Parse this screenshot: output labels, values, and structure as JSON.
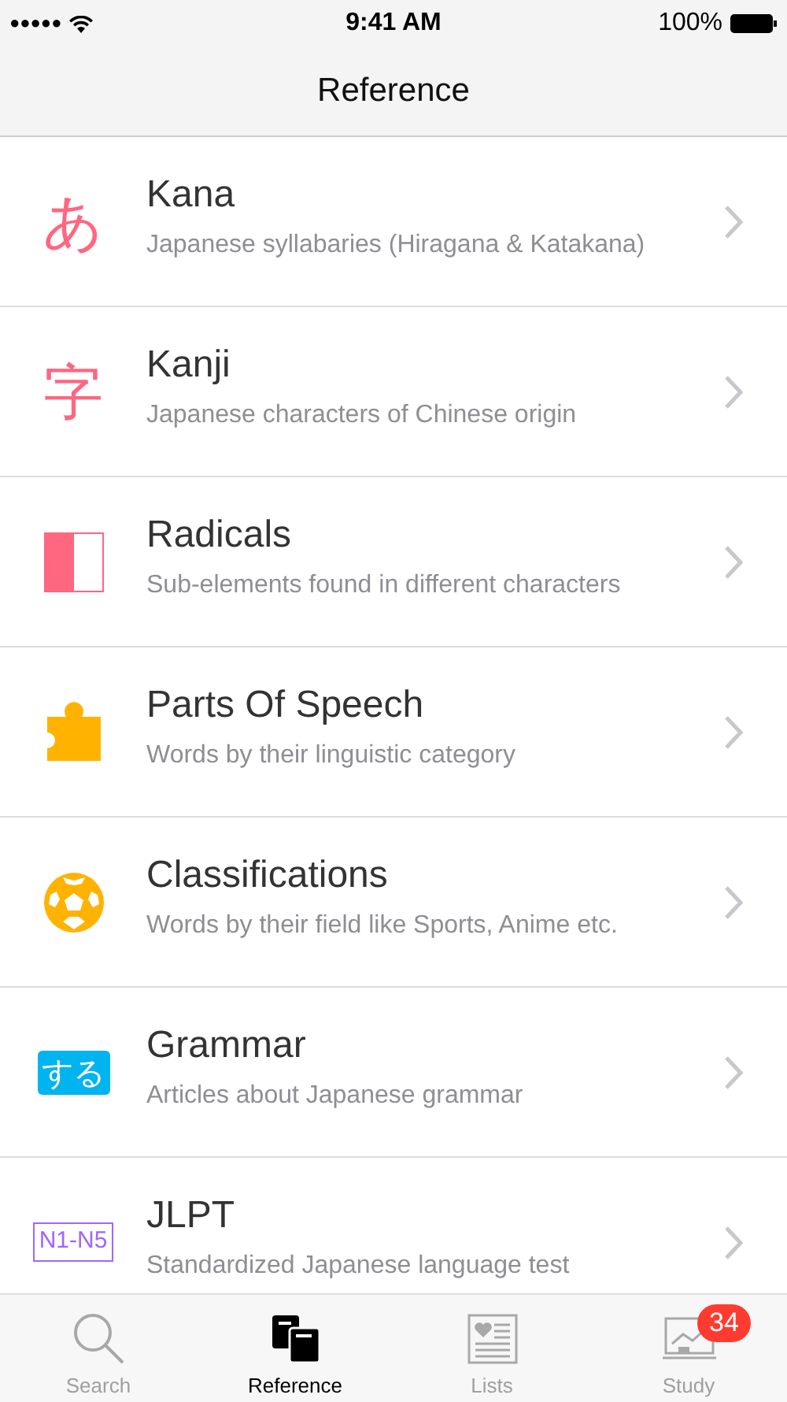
{
  "status_bar": {
    "signal": "●●●●●",
    "time": "9:41 AM",
    "battery": "100%"
  },
  "nav": {
    "title": "Reference"
  },
  "items": [
    {
      "kind": "glyph",
      "icon_text": "あ",
      "color": "#ff6680",
      "title": "Kana",
      "subtitle": "Japanese syllabaries (Hiragana & Katakana)"
    },
    {
      "kind": "glyph",
      "icon_text": "字",
      "color": "#ff6680",
      "title": "Kanji",
      "subtitle": "Japanese characters of Chinese origin"
    },
    {
      "kind": "half-square",
      "color": "#ff6680",
      "title": "Radicals",
      "subtitle": "Sub-elements found in different characters"
    },
    {
      "kind": "puzzle",
      "color": "#ffb300",
      "title": "Parts Of Speech",
      "subtitle": "Words by their linguistic category"
    },
    {
      "kind": "ball",
      "color": "#ffb300",
      "title": "Classifications",
      "subtitle": "Words by their field like Sports, Anime etc."
    },
    {
      "kind": "filled-badge",
      "icon_text": "する",
      "color": "#00b4f0",
      "title": "Grammar",
      "subtitle": "Articles about Japanese grammar"
    },
    {
      "kind": "outline-badge",
      "icon_text": "N1-N5",
      "color": "#a066ff",
      "title": "JLPT",
      "subtitle": "Standardized Japanese language test"
    }
  ],
  "tabs": [
    {
      "kind": "search",
      "label": "Search",
      "selected": false
    },
    {
      "kind": "books",
      "label": "Reference",
      "selected": true
    },
    {
      "kind": "list",
      "label": "Lists",
      "selected": false
    },
    {
      "kind": "study",
      "label": "Study",
      "selected": false,
      "badge": "34"
    }
  ]
}
